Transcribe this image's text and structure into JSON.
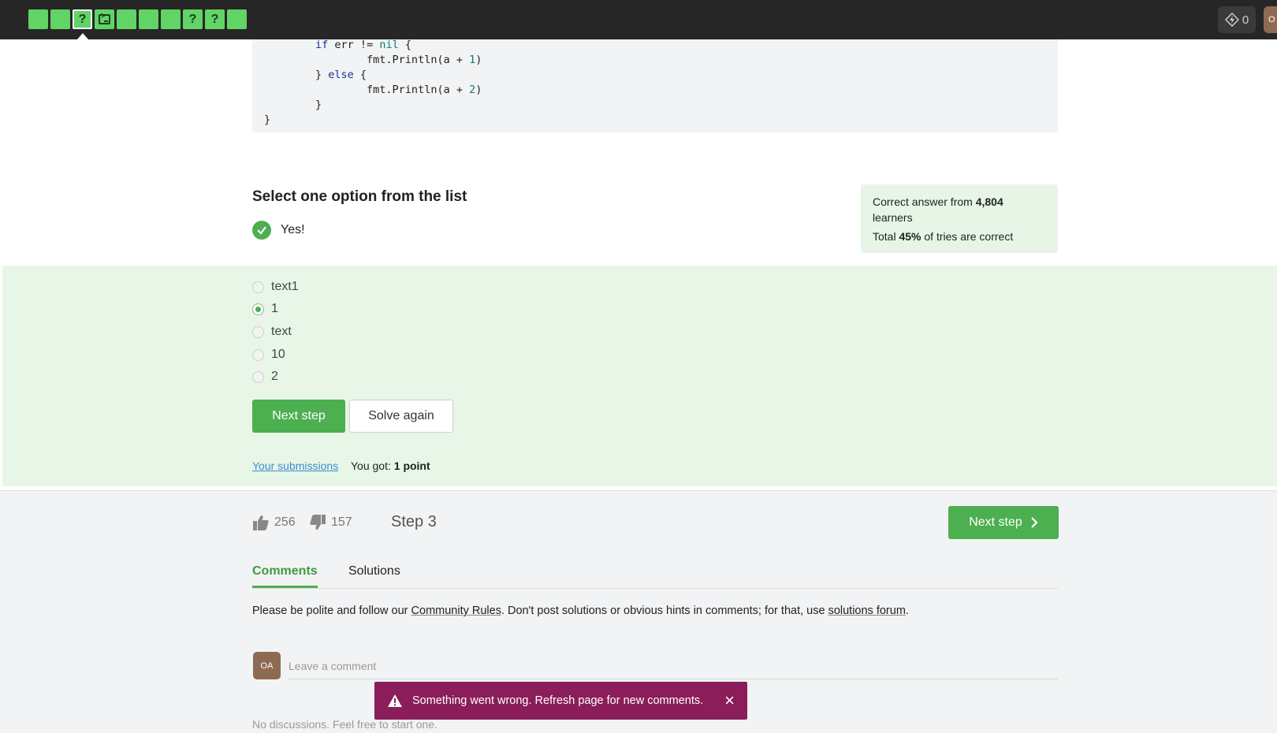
{
  "topbar": {
    "steps": [
      {
        "type": "done",
        "glyph": ""
      },
      {
        "type": "done",
        "glyph": ""
      },
      {
        "type": "active-quiz",
        "glyph": "?"
      },
      {
        "type": "code",
        "glyph": ""
      },
      {
        "type": "done",
        "glyph": ""
      },
      {
        "type": "done",
        "glyph": ""
      },
      {
        "type": "done",
        "glyph": ""
      },
      {
        "type": "quiz",
        "glyph": "?"
      },
      {
        "type": "quiz",
        "glyph": "?"
      },
      {
        "type": "done",
        "glyph": ""
      }
    ],
    "energy_count": "0",
    "user_initial": "O"
  },
  "code": {
    "lines": [
      "        if err != nil {",
      "                fmt.Println(a + 1)",
      "        } else {",
      "                fmt.Println(a + 2)",
      "        }",
      "}"
    ]
  },
  "question": {
    "title": "Select one option from the list",
    "verdict": "Yes!",
    "options": [
      {
        "label": "text1",
        "checked": false
      },
      {
        "label": "1",
        "checked": true
      },
      {
        "label": "text",
        "checked": false
      },
      {
        "label": "10",
        "checked": false
      },
      {
        "label": "2",
        "checked": false
      }
    ],
    "next_button": "Next step",
    "solve_again_button": "Solve again",
    "submissions_link": "Your submissions",
    "you_got_label": "You got:",
    "points": "1 point"
  },
  "stats": {
    "correct_prefix": "Correct answer from",
    "learners_count": "4,804",
    "learners_suffix": "learners",
    "total_prefix": "Total",
    "percent": "45%",
    "total_suffix": "of tries are correct"
  },
  "footer": {
    "likes": "256",
    "dislikes": "157",
    "step_label": "Step 3",
    "next_step_button": "Next step",
    "tabs": [
      "Comments",
      "Solutions"
    ],
    "active_tab": "Comments",
    "notice_pre": "Please be polite and follow our",
    "community_rules_link": "Community Rules",
    "notice_mid": ". Don't post solutions or obvious hints in comments; for that, use",
    "solutions_forum_link": "solutions forum",
    "notice_end": ".",
    "avatar_initials": "OA",
    "comment_placeholder": "Leave a comment",
    "empty_message": "No discussions. Feel free to start one."
  },
  "toast": {
    "message": "Something went wrong. Refresh page for new comments."
  },
  "colors": {
    "accent": "#4caf50",
    "toast_bg": "#8a1d5a",
    "topbar_bg": "#262626"
  }
}
